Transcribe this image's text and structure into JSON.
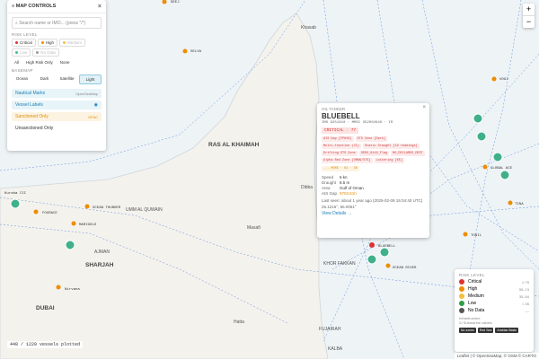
{
  "controls": {
    "title": "MAP CONTROLS",
    "search_placeholder": "Search name or IMO... (press \"/\")",
    "risk_label": "RISK LEVEL",
    "risk": [
      {
        "label": "Critical",
        "color": "#e03131"
      },
      {
        "label": "High",
        "color": "#f08c00"
      },
      {
        "label": "Medium",
        "color": "#f0c040"
      },
      {
        "label": "Low",
        "color": "#40c090"
      },
      {
        "label": "No Data",
        "color": "#999999"
      }
    ],
    "filters": [
      "All",
      "High Risk Only",
      "None"
    ],
    "basemap_label": "BASEMAP",
    "basemaps": [
      "Ocean",
      "Dark",
      "Satellite",
      "Light"
    ],
    "nautical": "Nautical Marks",
    "nautical_src": "OpenSeaMap",
    "vessel_labels": "Vessel Labels",
    "sanctioned": "Sanctioned Only",
    "sanctioned_src": "OFAC",
    "unsanctioned": "Unsanctioned Only"
  },
  "popup": {
    "type": "OIL TANKER",
    "name": "BLUEBELL",
    "ids": "IMO 9251810 · MMSI 352002640 · IR",
    "badge": "CRITICAL · 77",
    "tags": [
      "AIS Gap [FPH26]",
      "STS Zone [Dark]",
      "Multi-function (21)",
      "Static Draught [19 readings]",
      "Drifting STS Zone",
      "SEDO_8119_Flag",
      "NO_DECLARED_DEST",
      "Alpha Red Zone [OMAN/STS]",
      "Loitering [65]"
    ],
    "note": "... MORE · 64 · 30",
    "speed_label": "Speed",
    "speed": "6 kn",
    "draught_label": "Draught",
    "draught": "8.5 m",
    "area_label": "Area",
    "area": "Gulf of Oman",
    "ais_label": "AIS Gap",
    "ais": "9703.51h",
    "last_seen": "Last seen: about 1 year ago (2025-02-09 15:04:40 UTC)",
    "coords": "25.1216°, 56.0051°",
    "details": "View Details →"
  },
  "legend": {
    "title": "RISK LEVEL",
    "items": [
      {
        "label": "Critical",
        "sub": "≥ 75",
        "color": "#e03131"
      },
      {
        "label": "High",
        "sub": "55–74",
        "color": "#f08c00"
      },
      {
        "label": "Medium",
        "sub": "35–54",
        "color": "#f0c040"
      },
      {
        "label": "Low",
        "sub": "< 35",
        "color": "#2f9e44"
      },
      {
        "label": "No Data",
        "sub": "—",
        "color": "#555555"
      }
    ],
    "infra_label": "Infrastructure",
    "infra_toggle": "Submarine cables",
    "btns": [
      "No zones",
      "Red Sea",
      "Arabian Basin"
    ]
  },
  "status": "448 / 1220 vessels plotted",
  "attribution": "Leaflet | © OpenSeaMap, © OSM © CARTO",
  "places": [
    "RAS AL KHAIMAH",
    "SHARJAH",
    "DUBAI",
    "AJMAN",
    "UMM AL QUWAIN",
    "KHOR FAKKAN",
    "FUJAIRAH",
    "KALBA",
    "Khasab",
    "Dibba",
    "Masafi",
    "Hatta"
  ],
  "vessels": [
    "DEEJ",
    "SELVA",
    "VOGI",
    "GLOBAL ACE",
    "TINA",
    "TONIL",
    "FOURACE",
    "MARIGOLD",
    "OCEAN THUNDER",
    "BLUEBELL",
    "OCEAN RIVER",
    "Nirvana",
    "Kuraba III"
  ]
}
